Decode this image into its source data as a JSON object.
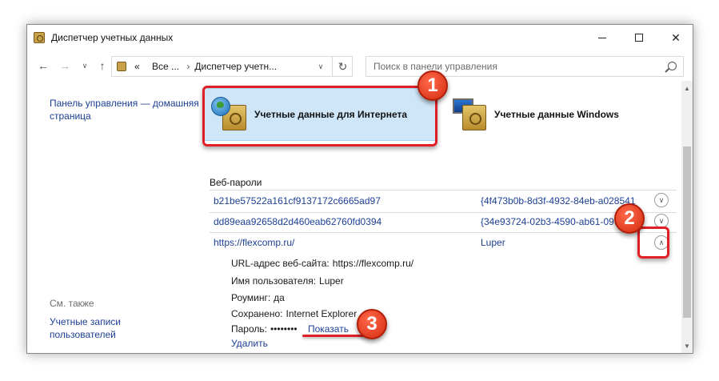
{
  "window": {
    "title": "Диспетчер учетных данных",
    "controls": {
      "minimize": "",
      "maximize": "",
      "close": "✕"
    }
  },
  "nav": {
    "back": "←",
    "forward": "→",
    "dropdown": "∨",
    "up": "↑",
    "breadcrumb": [
      "«",
      "Все ...",
      "›",
      "Диспетчер учетн..."
    ],
    "refresh": "↻",
    "search_placeholder": "Поиск в панели управления"
  },
  "sidebar": {
    "home_link": "Панель управления — домашняя страница",
    "see_also": "См. также",
    "user_accounts": "Учетные записи пользователей"
  },
  "tiles": {
    "web": "Учетные данные для Интернета",
    "windows": "Учетные данные Windows"
  },
  "web_passwords": {
    "header": "Веб-пароли",
    "rows": [
      {
        "resource": "b21be57522a161cf9137172c6665ad97",
        "user": "{4f473b0b-8d3f-4932-84eb-a028541",
        "toggle": "∨"
      },
      {
        "resource": "dd89eaa92658d2d460eab62760fd0394",
        "user": "{34e93724-02b3-4590-ab61-099",
        "toggle": "∨"
      },
      {
        "resource": "https://flexcomp.ru/",
        "user": "Luper",
        "toggle": "∧"
      }
    ],
    "details": {
      "url_label": "URL-адрес веб-сайта:",
      "url_value": "https://flexcomp.ru/",
      "user_label": "Имя пользователя:",
      "user_value": "Luper",
      "roaming_label": "Роуминг:",
      "roaming_value": "да",
      "saved_label": "Сохранено:",
      "saved_value": "Internet Explorer",
      "password_label": "Пароль:",
      "password_value": "••••••••",
      "show_link": "Показать",
      "delete_link": "Удалить"
    }
  },
  "annotations": {
    "one": "1",
    "two": "2",
    "three": "3"
  },
  "colors": {
    "accent_red": "#e21f26",
    "link_blue": "#1c3f94",
    "tile_selected": "#cfe6f8"
  }
}
